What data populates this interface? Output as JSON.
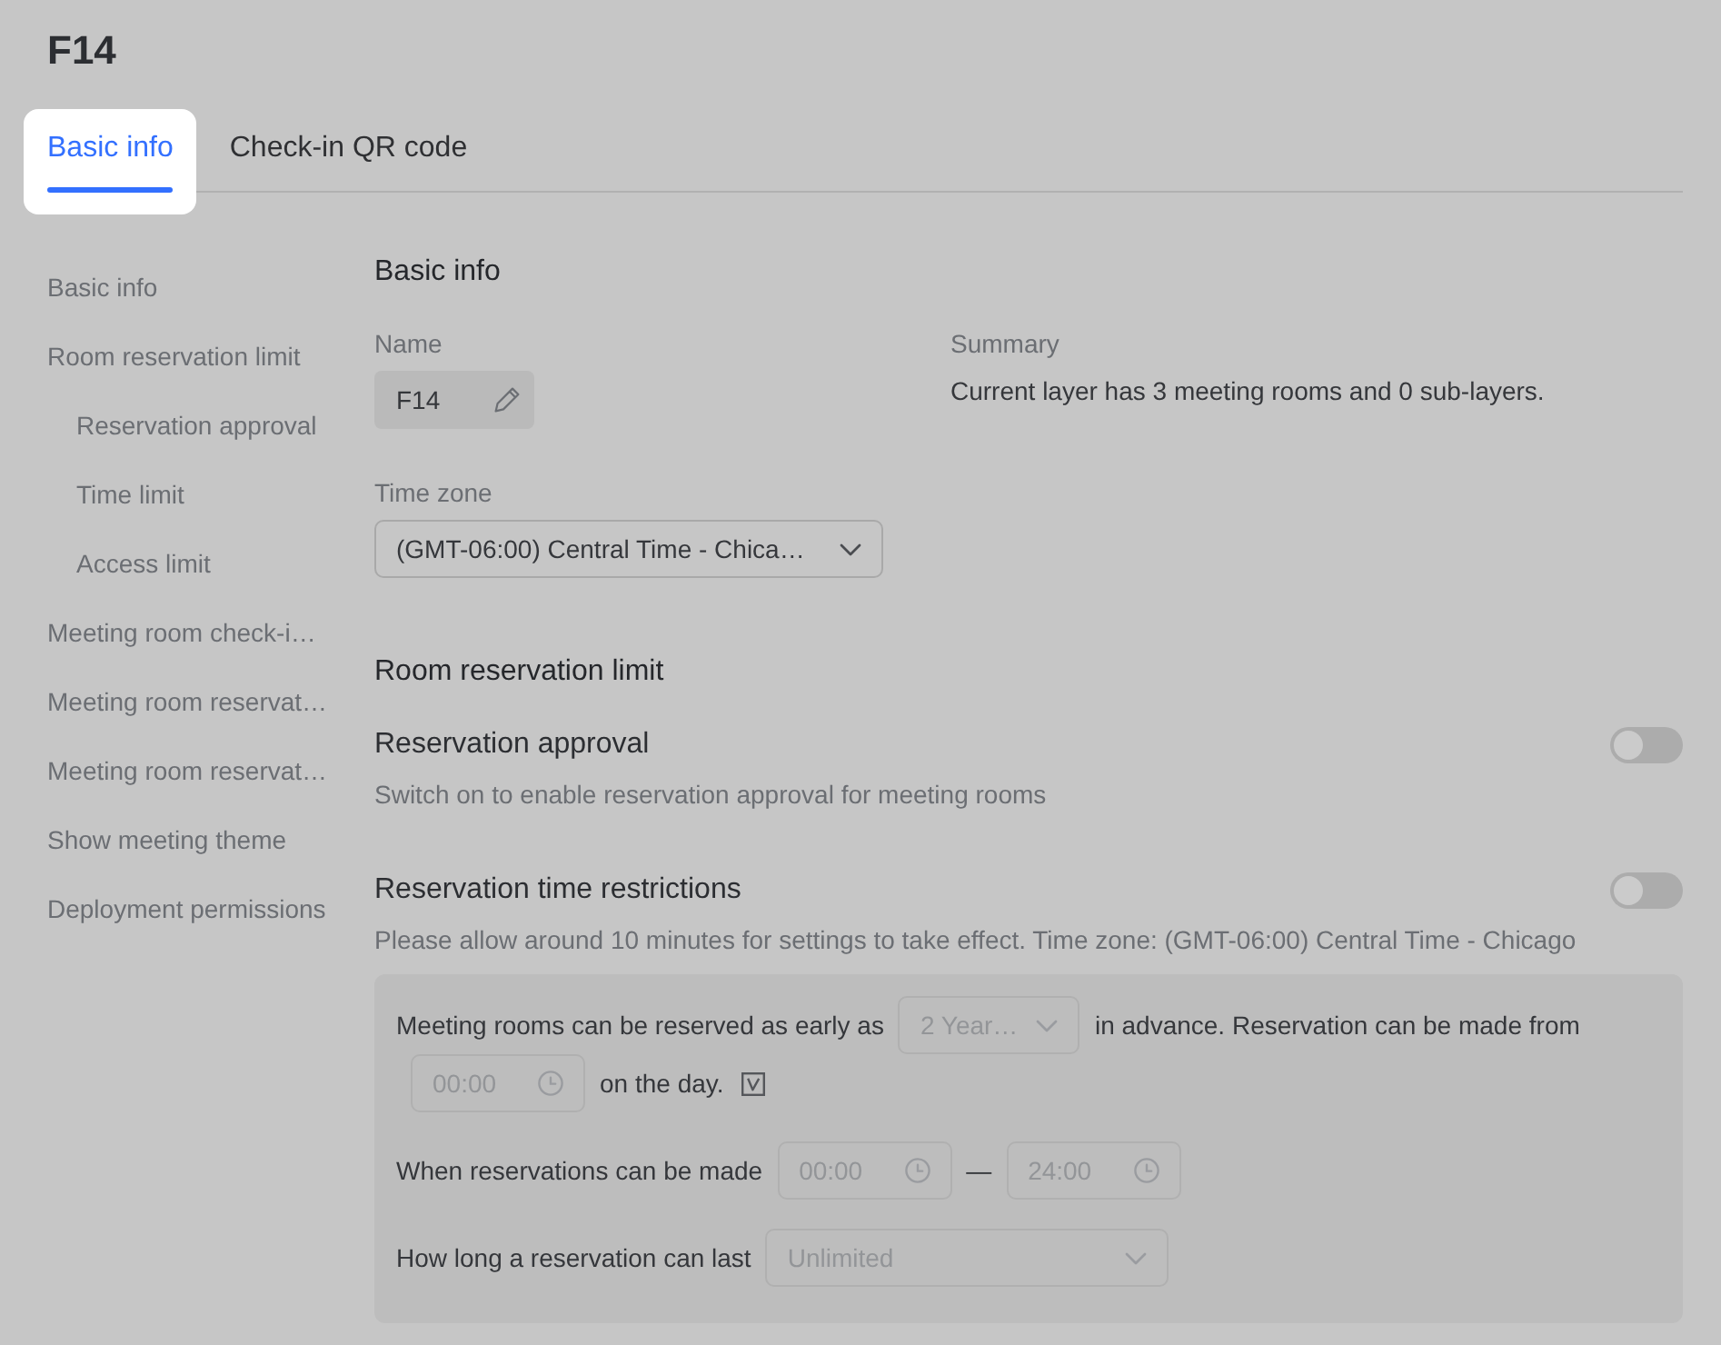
{
  "page": {
    "title": "F14"
  },
  "tabs": [
    {
      "label": "Basic info",
      "selected": true,
      "highlighted": true
    },
    {
      "label": "Check-in QR code",
      "selected": false,
      "highlighted": false
    }
  ],
  "sidebar": {
    "items": [
      {
        "label": "Basic info"
      },
      {
        "label": "Room reservation limit",
        "children": [
          {
            "label": "Reservation approval"
          },
          {
            "label": "Time limit"
          },
          {
            "label": "Access limit"
          }
        ]
      },
      {
        "label": "Meeting room check-i…"
      },
      {
        "label": "Meeting room reservat…"
      },
      {
        "label": "Meeting room reservat…"
      },
      {
        "label": "Show meeting theme"
      },
      {
        "label": "Deployment permissions"
      }
    ]
  },
  "basic_info": {
    "heading": "Basic info",
    "name": {
      "label": "Name",
      "value": "F14"
    },
    "summary": {
      "label": "Summary",
      "text": "Current layer has 3 meeting rooms and 0 sub-layers."
    },
    "time_zone": {
      "label": "Time zone",
      "value": "(GMT-06:00) Central Time - Chica…"
    }
  },
  "room_reservation_limit": {
    "heading": "Room reservation limit",
    "settings": [
      {
        "title": "Reservation approval",
        "description": "Switch on to enable reservation approval for meeting rooms",
        "on": false
      },
      {
        "title": "Reservation time restrictions",
        "description": "Please allow around 10 minutes for settings to take effect. Time zone: (GMT-06:00) Central Time - Chicago",
        "on": false,
        "rules": [
          {
            "parts": [
              {
                "kind": "text",
                "text": "Meeting rooms can be reserved as early as"
              },
              {
                "kind": "select",
                "value": "2 Year…",
                "disabled": true
              },
              {
                "kind": "text",
                "text": "in advance. Reservation can be made from"
              },
              {
                "kind": "time",
                "value": "00:00",
                "disabled": true
              },
              {
                "kind": "text",
                "text": "on the day."
              },
              {
                "kind": "icon"
              }
            ]
          },
          {
            "parts": [
              {
                "kind": "text",
                "text": "When reservations can be made"
              },
              {
                "kind": "time",
                "value": "00:00",
                "disabled": true
              },
              {
                "kind": "text",
                "text": "—"
              },
              {
                "kind": "time",
                "value": "24:00",
                "disabled": true
              }
            ]
          },
          {
            "parts": [
              {
                "kind": "text",
                "text": "How long a reservation can last"
              },
              {
                "kind": "select",
                "value": "Unlimited",
                "disabled": true
              }
            ]
          }
        ]
      }
    ]
  }
}
